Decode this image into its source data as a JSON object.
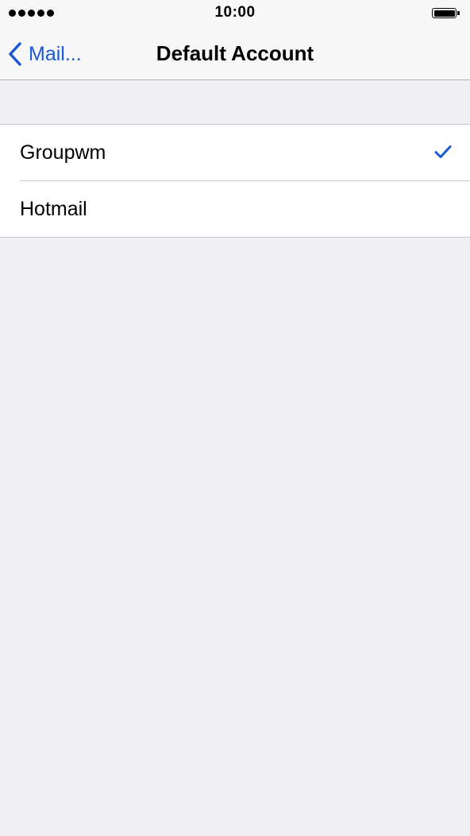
{
  "status_bar": {
    "time": "10:00",
    "signal_icon": "signal-dots-icon",
    "battery_icon": "battery-full-icon"
  },
  "nav": {
    "back_label": "Mail...",
    "back_icon": "chevron-left-icon",
    "title": "Default Account"
  },
  "accounts": [
    {
      "label": "Groupwm",
      "selected": true
    },
    {
      "label": "Hotmail",
      "selected": false
    }
  ],
  "colors": {
    "accent": "#1a5ad6",
    "background": "#efeff4",
    "bar": "#f7f7f7"
  }
}
